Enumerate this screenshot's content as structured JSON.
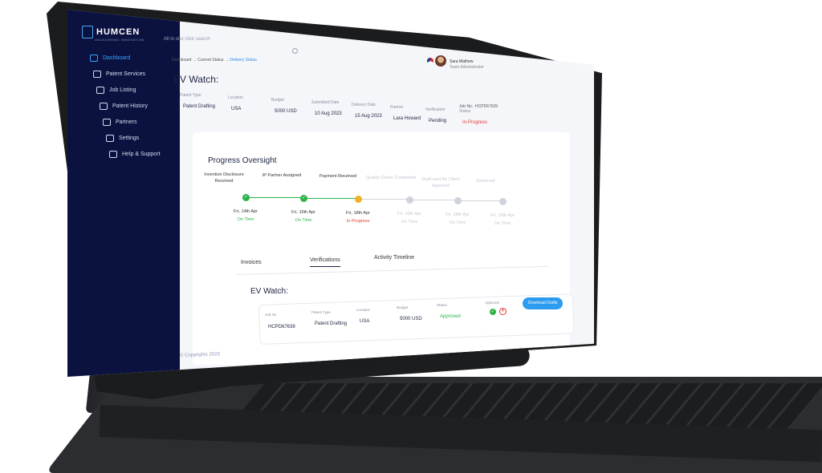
{
  "app": {
    "logo": "HUMCEN",
    "logo_tagline": "UNLEASHING INNOVATION",
    "copyright": "© Copyrights 2023"
  },
  "sidebar": {
    "items": [
      {
        "label": "Dashboard",
        "icon": "grid-icon",
        "active": true
      },
      {
        "label": "Patent Services",
        "icon": "document-icon",
        "active": false
      },
      {
        "label": "Job Listing",
        "icon": "search-list-icon",
        "active": false
      },
      {
        "label": "Patent History",
        "icon": "history-icon",
        "active": false
      },
      {
        "label": "Partners",
        "icon": "folder-icon",
        "active": false
      },
      {
        "label": "Settings",
        "icon": "gear-icon",
        "active": false
      },
      {
        "label": "Help & Support",
        "icon": "help-icon",
        "active": false
      }
    ]
  },
  "header": {
    "search_placeholder": "All in one click search",
    "user_name": "Sara Mathew",
    "user_role": "Team Administrator"
  },
  "breadcrumb": {
    "items": [
      "Dashboard",
      "Current Status",
      "Delivery Status"
    ],
    "separator": "→"
  },
  "page": {
    "title": "EV Watch:",
    "job_no_label": "Job No.:",
    "job_no": "HCPD67639"
  },
  "info": {
    "fields": [
      {
        "label": "Patent Type",
        "value": "Patent Drafting"
      },
      {
        "label": "Location",
        "value": "USA"
      },
      {
        "label": "Budget",
        "value": "5000 USD"
      },
      {
        "label": "Submitted Date",
        "value": "10 Aug 2023"
      },
      {
        "label": "Delivery Date",
        "value": "15 Aug 2023"
      },
      {
        "label": "Partner",
        "value": "Lara Howard"
      },
      {
        "label": "Verification",
        "value": "Pending"
      },
      {
        "label": "Status",
        "value": "In-Progress"
      }
    ]
  },
  "progress": {
    "title": "Progress Oversight",
    "steps": [
      {
        "label": "Invention Disclosure Received",
        "date": "Fri, 14th Apr",
        "status": "On Time",
        "state": "done"
      },
      {
        "label": "IP Partner Assigned",
        "date": "Fri, 16th Apr",
        "status": "On Time",
        "state": "done"
      },
      {
        "label": "Payment Received",
        "date": "Fri, 18th Apr",
        "status": "In-Progress",
        "state": "current"
      },
      {
        "label": "Quality Check Completed",
        "date": "Fri, 16th Apr",
        "status": "On Time",
        "state": "pending"
      },
      {
        "label": "Draft sent for Client Approval",
        "date": "Fri, 18th Apr",
        "status": "On Time",
        "state": "pending"
      },
      {
        "label": "Delivered",
        "date": "Fri, 16th Apr",
        "status": "On Time",
        "state": "pending"
      }
    ]
  },
  "tabs": [
    {
      "label": "Invoices",
      "active": false
    },
    {
      "label": "Verifications",
      "active": true
    },
    {
      "label": "Activity Timeline",
      "active": false
    }
  ],
  "verification": {
    "title": "EV Watch:",
    "columns": [
      "Job No",
      "Patent Type",
      "Location",
      "Budget",
      "Status",
      "Approval"
    ],
    "row": {
      "job_no": "HCPD67639",
      "patent_type": "Patent Drafting",
      "location": "USA",
      "budget": "5000 USD",
      "status": "Approved"
    },
    "download_label": "Download Drafts"
  },
  "colors": {
    "sidebar_bg": "#0b1240",
    "accent_blue": "#2d9cf0",
    "success_green": "#2db24a",
    "warning_amber": "#f0b323",
    "error_red": "#e53935"
  }
}
